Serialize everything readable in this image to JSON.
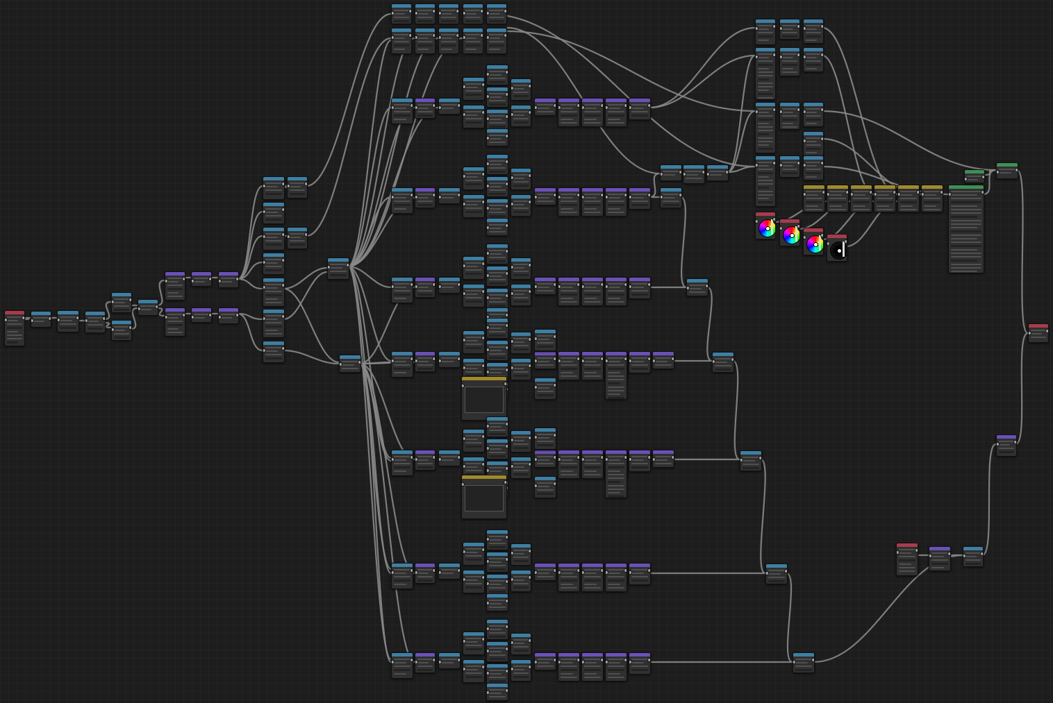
{
  "editor": {
    "title": "",
    "link_color": "#8a8a8a",
    "grid_color": "#232323",
    "background": "#1d1d1d"
  },
  "node_colors": {
    "input": "#a83b4c",
    "converter": "#3e7fa3",
    "math": "#6b50b8",
    "group": "#a08a2a",
    "output": "#3f8f55"
  },
  "icons": {
    "color_wheel": "color-wheel-icon",
    "dark_wheel": "dark-wheel-icon",
    "curve": "curve-graph-icon"
  }
}
